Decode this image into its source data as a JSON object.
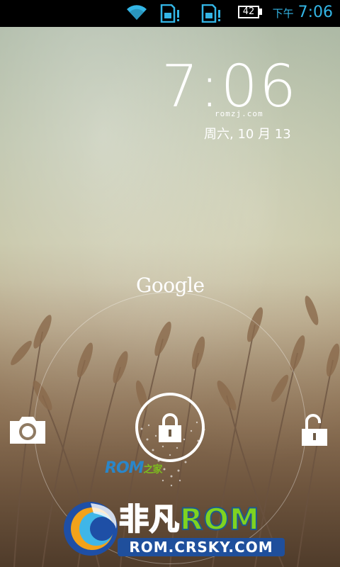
{
  "status_bar": {
    "ampm": "下午",
    "time": "7:06",
    "battery_level": "42",
    "icons": [
      "wifi-icon",
      "sim1-alert-icon",
      "sim2-alert-icon",
      "battery-icon"
    ]
  },
  "lockscreen": {
    "clock": "7:06",
    "watermark_text": "romzj.com",
    "date": "周六, 10 月 13",
    "search_label": "Google",
    "targets": [
      "camera-icon",
      "lock-icon",
      "unlock-icon"
    ]
  },
  "watermarks": {
    "romzj_main": "ROM",
    "romzj_suffix": "之家",
    "crsky_cn": "非凡",
    "crsky_rom": "ROM",
    "crsky_url": "ROM.CRSKY.COM"
  },
  "colors": {
    "accent": "#33b5e5",
    "clock": "#ffffff"
  }
}
